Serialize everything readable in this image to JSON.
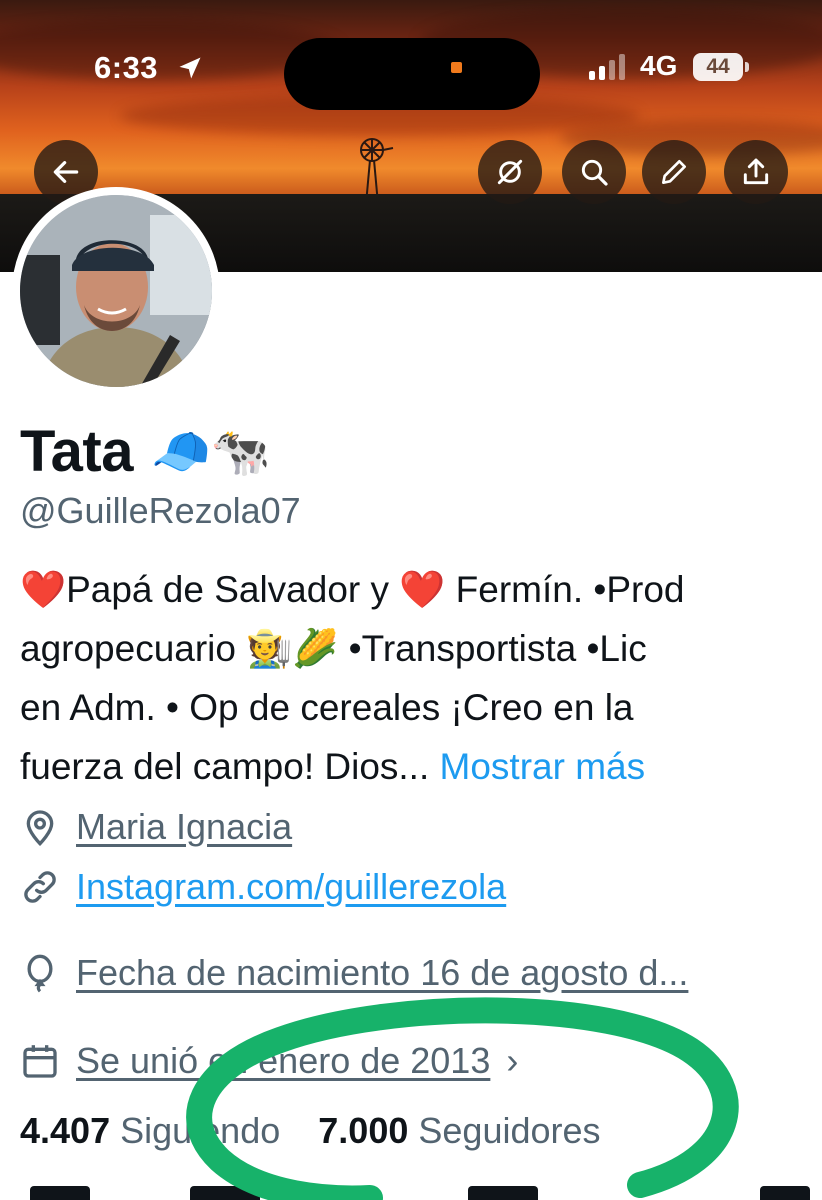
{
  "status_bar": {
    "time": "6:33",
    "network": "4G",
    "battery": "44"
  },
  "profile": {
    "display_name": "Tata",
    "name_emojis": "🧢🐄",
    "handle": "@GuilleRezola07",
    "bio": {
      "line1_a": "❤️",
      "line1_b": "Papá de Salvador y ",
      "line1_c": "❤️",
      "line1_d": " Fermín. •Prod",
      "line2": "agropecuario 🧑‍🌾🌽 •Transportista •Lic",
      "line3": "en Adm. • Op de cereales ¡Creo en la",
      "line4": "fuerza del campo! Dios... ",
      "show_more": "Mostrar más"
    },
    "location": "Maria Ignacia",
    "website": "Instagram.com/guillerezola",
    "birthday": "Fecha de nacimiento 16 de agosto d...",
    "joined": "Se unió en enero de 2013",
    "following_count": "4.407",
    "following_label": "Siguiendo",
    "followers_count": "7.000",
    "followers_label": "Seguidores"
  },
  "colors": {
    "text": "#0f1419",
    "secondary": "#536471",
    "link": "#1d9bf0",
    "annotation_circle": "#17b26a"
  },
  "icons": {
    "back": "arrow-left-icon",
    "mute": "bell-slash-icon",
    "search": "search-icon",
    "edit": "pencil-icon",
    "share": "share-icon",
    "location": "location-pin-icon",
    "link": "link-icon",
    "birthday": "balloon-icon",
    "calendar": "calendar-icon"
  }
}
